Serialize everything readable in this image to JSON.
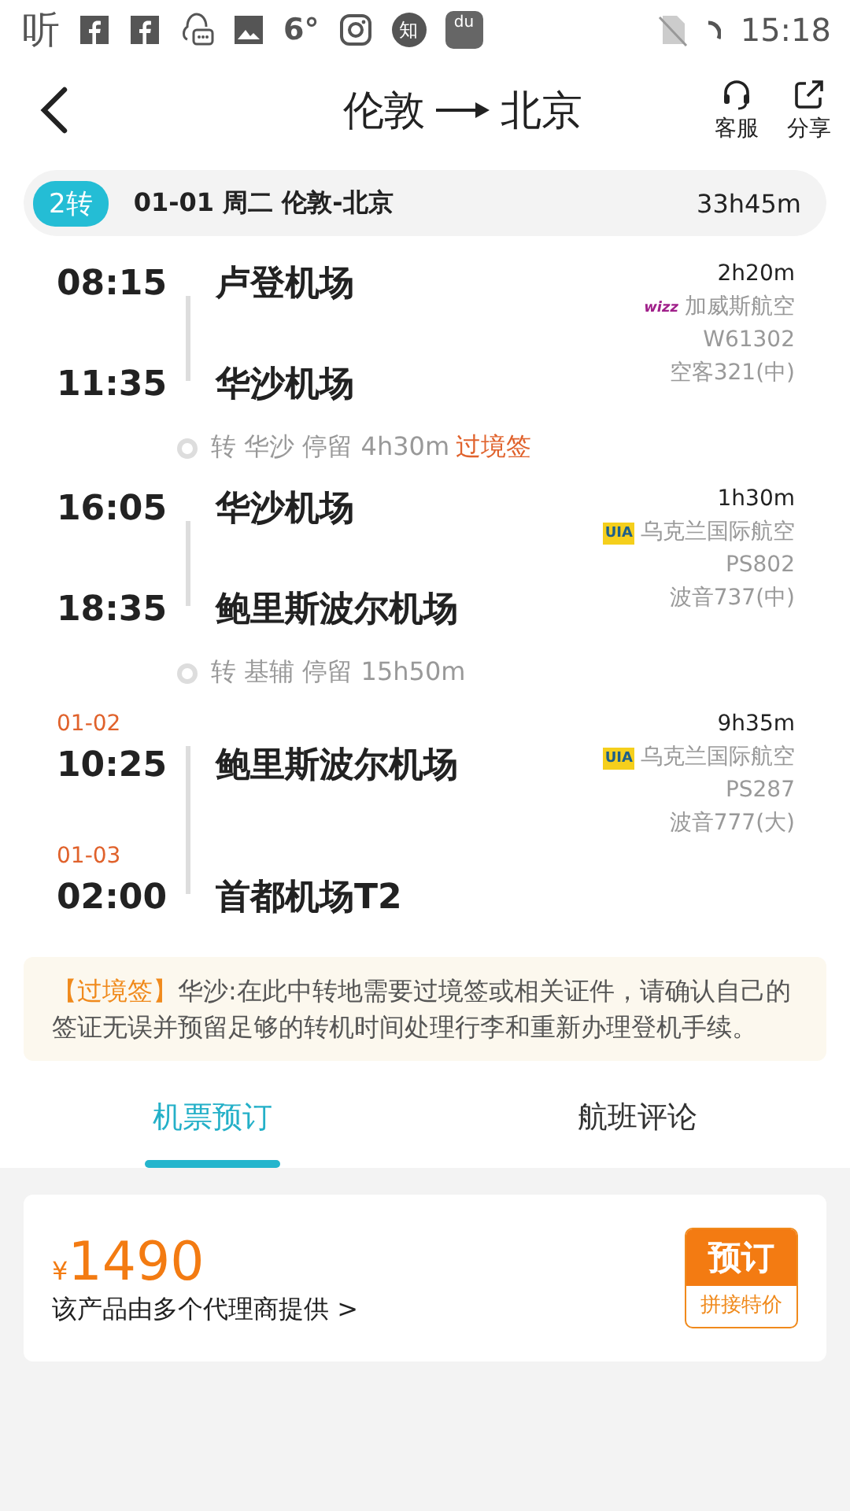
{
  "status_bar": {
    "app_logo": "听",
    "temperature": "6°",
    "zhihu": "知",
    "baidu": "du",
    "time": "15:18"
  },
  "header": {
    "from": "伦敦",
    "to": "北京",
    "actions": [
      {
        "kind": "service",
        "label": "客服"
      },
      {
        "kind": "share",
        "label": "分享"
      }
    ]
  },
  "summary": {
    "badge": "2转",
    "text": "01-01 周二 伦敦-北京",
    "duration": "33h45m"
  },
  "itinerary": [
    {
      "kind": "flight",
      "dep_time": "08:15",
      "dep_airport": "卢登机场",
      "arr_time": "11:35",
      "arr_airport": "华沙机场",
      "duration": "2h20m",
      "logo": {
        "kind": "wizz",
        "text": "wizz"
      },
      "airline": "加威斯航空",
      "flight_no": "W61302",
      "aircraft": "空客321(中)"
    },
    {
      "kind": "transfer",
      "text": "转 华沙 停留 4h30m",
      "tag": "过境签"
    },
    {
      "kind": "flight",
      "dep_time": "16:05",
      "dep_airport": "华沙机场",
      "arr_time": "18:35",
      "arr_airport": "鲍里斯波尔机场",
      "duration": "1h30m",
      "logo": {
        "kind": "uia",
        "text": "UIA"
      },
      "airline": "乌克兰国际航空",
      "flight_no": "PS802",
      "aircraft": "波音737(中)"
    },
    {
      "kind": "transfer",
      "text": "转 基辅 停留 15h50m"
    },
    {
      "kind": "flight",
      "dep_date": "01-02",
      "dep_time": "10:25",
      "dep_airport": "鲍里斯波尔机场",
      "arr_date": "01-03",
      "arr_time": "02:00",
      "arr_airport": "首都机场T2",
      "duration": "9h35m",
      "logo": {
        "kind": "uia",
        "text": "UIA"
      },
      "airline": "乌克兰国际航空",
      "flight_no": "PS287",
      "aircraft": "波音777(大)"
    }
  ],
  "notice": {
    "tag": "【过境签】",
    "text": "华沙:在此中转地需要过境签或相关证件，请确认自己的签证无误并预留足够的转机时间处理行李和重新办理登机手续。"
  },
  "tabs": [
    {
      "label": "机票预订",
      "selected": true
    },
    {
      "label": "航班评论",
      "selected": false
    }
  ],
  "offer": {
    "currency": "¥",
    "price": "1490",
    "provider": "该产品由多个代理商提供 >",
    "book": "预订",
    "book_sub": "拼接特价"
  }
}
